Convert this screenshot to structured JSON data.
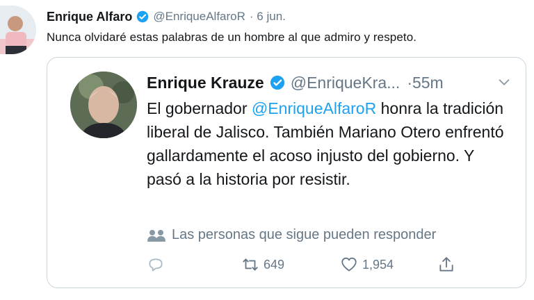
{
  "outer_tweet": {
    "name": "Enrique Alfaro",
    "handle": "@EnriqueAlfaroR",
    "time": "· 6 jun.",
    "text": "Nunca olvidaré estas palabras de un hombre al que admiro y respeto."
  },
  "quoted_tweet": {
    "name": "Enrique Krauze",
    "handle": "@EnriqueKra...",
    "time": "·55m",
    "text_before": "El gobernador ",
    "mention": "@EnriqueAlfaroR",
    "text_after": " honra la tradición liberal de Jalisco. También Mariano Otero enfrentó gallardamente el acoso injusto del gobierno. Y pasó a la historia por resistir.",
    "reply_note": "Las personas que sigue pueden responder",
    "retweets": "649",
    "likes": "1,954"
  },
  "colors": {
    "accent": "#1da1f2",
    "secondary_text": "#657786",
    "border": "#ccd6dd"
  },
  "icons": [
    "verified-icon",
    "chevron-down-icon",
    "people-icon",
    "reply-icon",
    "retweet-icon",
    "heart-icon",
    "share-icon"
  ]
}
